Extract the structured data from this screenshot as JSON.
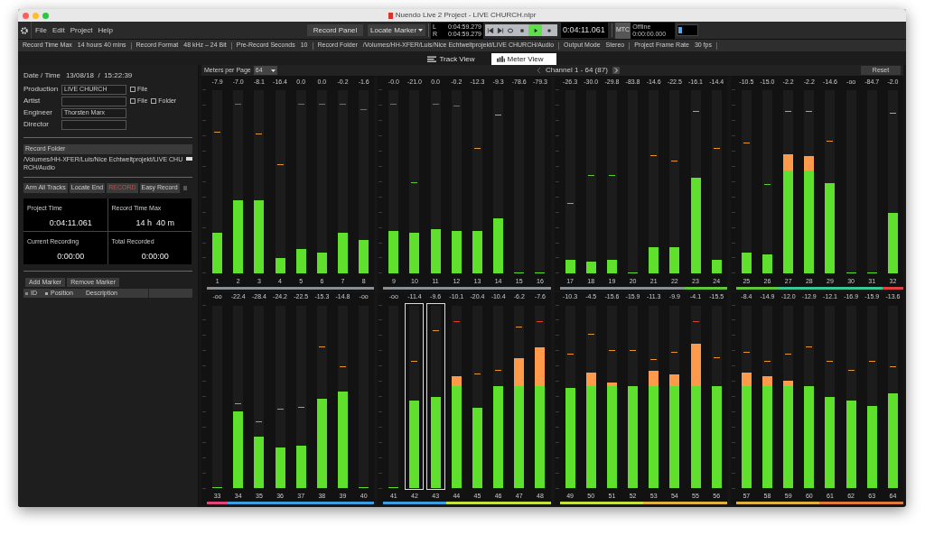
{
  "window": {
    "title": "Nuendo Live 2 Project - LIVE CHURCH.nlpr"
  },
  "menu": [
    "File",
    "Edit",
    "Project",
    "Help"
  ],
  "toolbar": {
    "record_panel": "Record Panel",
    "locate": "Locate Marker",
    "locators": [
      {
        "label": "L",
        "time": "0:04:59.279"
      },
      {
        "label": "R",
        "time": "0:04:59.279"
      }
    ],
    "transport": [
      {
        "kind": "start",
        "active": false
      },
      {
        "kind": "end",
        "active": false
      },
      {
        "kind": "cycle",
        "active": false
      },
      {
        "kind": "stop",
        "active": false
      },
      {
        "kind": "play",
        "active": true
      },
      {
        "kind": "record",
        "active": false
      }
    ],
    "time": "0:04:11.061",
    "mtc": {
      "label": "MTC",
      "status": "Offline",
      "time": "0:00:00.000"
    }
  },
  "info_bar": [
    {
      "label": "Record Time Max",
      "value": "14 hours 40 mins"
    },
    {
      "label": "Record Format",
      "value": "48 kHz – 24 Bit"
    },
    {
      "label": "Pre-Record Seconds",
      "value": "10"
    },
    {
      "label": "Record Folder",
      "value": "/Volumes/HH-XFER/Luis/Nice Echtweltprojekt/LIVE CHURCH/Audio"
    },
    {
      "label": "Output Mode",
      "value": "Stereo"
    },
    {
      "label": "Project Frame Rate",
      "value": "30 fps"
    }
  ],
  "tabs": [
    {
      "label": "Track View",
      "selected": false
    },
    {
      "label": "Meter View",
      "selected": true
    }
  ],
  "left_panel": {
    "datetime": {
      "label": "Date / Time",
      "value": "13/08/18  /  15:22:39"
    },
    "fields": [
      {
        "label": "Production",
        "value": "LIVE CHURCH",
        "checkboxes": [
          {
            "label": "File",
            "checked": false
          }
        ]
      },
      {
        "label": "Artist",
        "checkboxes": [
          {
            "label": "File",
            "checked": false
          },
          {
            "label": "Folder",
            "checked": false
          }
        ]
      },
      {
        "label": "Engineer",
        "value": "Thorsten Marx"
      },
      {
        "label": "Director"
      }
    ],
    "record_folder": {
      "title": "Record Folder",
      "path": "/Volumes/HH-XFER/Luis/Nice Echtweltprojekt/LIVE CHURCH/Audio"
    },
    "buttons": [
      {
        "label": "Arm All Tracks",
        "kind": "normal"
      },
      {
        "label": "Locate End",
        "kind": "normal"
      },
      {
        "label": "RECORD",
        "kind": "record"
      },
      {
        "label": "Easy Record",
        "kind": "normal"
      }
    ],
    "stats": [
      {
        "label": "Project Time",
        "value": "0:04:11.061"
      },
      {
        "label": "Record Time Max",
        "value": "14 h  40 m"
      },
      {
        "label": "Current Recording",
        "value": "0:00:00"
      },
      {
        "label": "Total Recorded",
        "value": "0:00:00"
      }
    ],
    "marker_buttons": [
      "Add Marker",
      "Remove Marker"
    ],
    "marker_columns": [
      "ID",
      "Position",
      "Description"
    ]
  },
  "meters": {
    "meters_per_page": {
      "label": "Meters per Page",
      "value": "64"
    },
    "channel_label": "Channel 1 - 64 (87)",
    "reset": "Reset",
    "rows": [
      {
        "channels": [
          {
            "number": "1",
            "reading": "-7.9",
            "level": 0.22,
            "peak_hold": {
              "level": 0.77
            },
            "color": "#8a8f94",
            "selected": false
          },
          {
            "number": "2",
            "reading": "-7.0",
            "level": 0.4,
            "peak_hold": {
              "level": 0.92
            },
            "color": "#8a8f94",
            "selected": false
          },
          {
            "number": "3",
            "reading": "-8.1",
            "level": 0.4,
            "peak_hold": {
              "level": 0.76
            },
            "color": "#8a8f94",
            "selected": false
          },
          {
            "number": "4",
            "reading": "-16.4",
            "level": 0.08,
            "peak_hold": {
              "level": 0.59
            },
            "color": "#8a8f94",
            "selected": false
          },
          {
            "number": "5",
            "reading": "0.0",
            "level": 0.13,
            "peak_hold": {
              "level": 0.92
            },
            "color": "#8a8f94",
            "selected": false
          },
          {
            "number": "6",
            "reading": "0.0",
            "level": 0.11,
            "peak_hold": {
              "level": 0.92
            },
            "color": "#8a8f94",
            "selected": false
          },
          {
            "number": "7",
            "reading": "-0.2",
            "level": 0.22,
            "peak_hold": {
              "level": 0.92
            },
            "color": "#8a8f94",
            "selected": false
          },
          {
            "number": "8",
            "reading": "-1.6",
            "level": 0.18,
            "peak_hold": {
              "level": 0.89
            },
            "color": "#8a8f94",
            "selected": false
          },
          {
            "number": "9",
            "reading": "-0.0",
            "level": 0.23,
            "peak_hold": {
              "level": 0.92
            },
            "color": "#8a8f94",
            "selected": false
          },
          {
            "number": "10",
            "reading": "-21.0",
            "level": 0.22,
            "peak_hold": {
              "level": 0.49
            },
            "color": "#8a8f94",
            "selected": false
          },
          {
            "number": "11",
            "reading": "0.0",
            "level": 0.24,
            "peak_hold": {
              "level": 0.92
            },
            "color": "#8a8f94",
            "selected": false
          },
          {
            "number": "12",
            "reading": "-0.2",
            "level": 0.23,
            "peak_hold": {
              "level": 0.91
            },
            "color": "#8a8f94",
            "selected": false
          },
          {
            "number": "13",
            "reading": "-12.3",
            "level": 0.23,
            "peak_hold": {
              "level": 0.68
            },
            "color": "#8a8f94",
            "selected": false
          },
          {
            "number": "14",
            "reading": "-9.3",
            "level": 0.3,
            "peak_hold": {
              "level": 0.86
            },
            "color": "#8a8f94",
            "selected": false
          },
          {
            "number": "15",
            "reading": "-78.6",
            "level": 0,
            "color": "#8a8f94",
            "selected": false
          },
          {
            "number": "16",
            "reading": "-79.3",
            "level": 0,
            "color": "#8a8f94",
            "selected": false
          },
          {
            "number": "17",
            "reading": "-26.3",
            "level": 0.07,
            "peak_hold": {
              "level": 0.38
            },
            "color": "#8a8f94",
            "selected": false
          },
          {
            "number": "18",
            "reading": "-30.0",
            "level": 0.06,
            "peak_hold": {
              "level": 0.53
            },
            "color": "#8a8f94",
            "selected": false
          },
          {
            "number": "19",
            "reading": "-29.8",
            "level": 0.07,
            "peak_hold": {
              "level": 0.53
            },
            "color": "#8a8f94",
            "selected": false
          },
          {
            "number": "20",
            "reading": "-83.8",
            "level": 0,
            "color": "#8a8f94",
            "selected": false
          },
          {
            "number": "21",
            "reading": "-14.6",
            "level": 0.14,
            "peak_hold": {
              "level": 0.64
            },
            "color": "#8a8f94",
            "selected": false
          },
          {
            "number": "22",
            "reading": "-22.5",
            "level": 0.14,
            "peak_hold": {
              "level": 0.61
            },
            "color": "#8a8f94",
            "selected": false
          },
          {
            "number": "23",
            "reading": "-16.1",
            "level": 0.52,
            "peak_hold": {
              "level": 0.88
            },
            "color": "#5fc53a",
            "selected": false
          },
          {
            "number": "24",
            "reading": "-14.4",
            "level": 0.07,
            "peak_hold": {
              "level": 0.68
            },
            "color": "#5fc53a",
            "selected": false
          },
          {
            "number": "25",
            "reading": "-10.5",
            "level": 0.11,
            "peak_hold": {
              "level": 0.71
            },
            "color": "#5fc53a",
            "selected": false
          },
          {
            "number": "26",
            "reading": "-15.0",
            "level": 0.1,
            "peak_hold": {
              "level": 0.48
            },
            "color": "#5fc53a",
            "selected": false
          },
          {
            "number": "27",
            "reading": "-2.2",
            "level": 0.65,
            "peak_hold": {
              "level": 0.88
            },
            "color": "#39c79a",
            "selected": false
          },
          {
            "number": "28",
            "reading": "-2.2",
            "level": 0.64,
            "peak_hold": {
              "level": 0.88
            },
            "color": "#39c79a",
            "selected": false
          },
          {
            "number": "29",
            "reading": "-14.6",
            "level": 0.49,
            "peak_hold": {
              "level": 0.72
            },
            "color": "#39c79a",
            "selected": false
          },
          {
            "number": "30",
            "reading": "-oo",
            "level": 0,
            "color": "#39c79a",
            "selected": false
          },
          {
            "number": "31",
            "reading": "-84.7",
            "level": 0,
            "color": "#39c79a",
            "selected": false
          },
          {
            "number": "32",
            "reading": "-2.0",
            "level": 0.33,
            "peak_hold": {
              "level": 0.87
            },
            "color": "#e04040",
            "selected": false
          }
        ]
      },
      {
        "channels": [
          {
            "number": "33",
            "reading": "-oo",
            "level": 0,
            "color": "#e0457b",
            "selected": false
          },
          {
            "number": "34",
            "reading": "-22.4",
            "level": 0.42,
            "peak_hold": {
              "level": 0.46
            },
            "color": "#3b9ee0",
            "selected": false
          },
          {
            "number": "35",
            "reading": "-28.4",
            "level": 0.28,
            "peak_hold": {
              "level": 0.36
            },
            "color": "#3b9ee0",
            "selected": false
          },
          {
            "number": "36",
            "reading": "-24.2",
            "level": 0.22,
            "peak_hold": {
              "level": 0.43
            },
            "color": "#3b9ee0",
            "selected": false
          },
          {
            "number": "37",
            "reading": "-22.5",
            "level": 0.23,
            "peak_hold": {
              "level": 0.44
            },
            "color": "#3b9ee0",
            "selected": false
          },
          {
            "number": "38",
            "reading": "-15.3",
            "level": 0.49,
            "peak_hold": {
              "level": 0.77
            },
            "color": "#3b9ee0",
            "selected": false
          },
          {
            "number": "39",
            "reading": "-14.8",
            "level": 0.53,
            "peak_hold": {
              "level": 0.66
            },
            "color": "#3b9ee0",
            "selected": false
          },
          {
            "number": "40",
            "reading": "-oo",
            "level": 0,
            "color": "#3b9ee0",
            "selected": false
          },
          {
            "number": "41",
            "reading": "-oo",
            "level": 0,
            "color": "#3b9ee0",
            "selected": false
          },
          {
            "number": "42",
            "reading": "-11.4",
            "level": 0.48,
            "peak_hold": {
              "level": 0.69
            },
            "color": "#3b9ee0",
            "selected": true
          },
          {
            "number": "43",
            "reading": "-9.6",
            "level": 0.5,
            "peak_hold": {
              "level": 0.86
            },
            "color": "#3b9ee0",
            "selected": true
          },
          {
            "number": "44",
            "reading": "-10.1",
            "level": 0.61,
            "peak_hold": {
              "level": 0.91
            },
            "color": "#c8e03c",
            "selected": false
          },
          {
            "number": "45",
            "reading": "-20.4",
            "level": 0.44,
            "peak_hold": {
              "level": 0.62
            },
            "color": "#c8e03c",
            "selected": false
          },
          {
            "number": "46",
            "reading": "-10.4",
            "level": 0.56,
            "peak_hold": {
              "level": 0.64
            },
            "color": "#c8e03c",
            "selected": false
          },
          {
            "number": "47",
            "reading": "-6.2",
            "level": 0.71,
            "peak_hold": {
              "level": 0.88
            },
            "color": "#c8e03c",
            "selected": false
          },
          {
            "number": "48",
            "reading": "-7.6",
            "level": 0.77,
            "peak_hold": {
              "level": 0.91
            },
            "color": "#c8e03c",
            "selected": false
          },
          {
            "number": "49",
            "reading": "-10.3",
            "level": 0.55,
            "peak_hold": {
              "level": 0.73
            },
            "color": "#c8e03c",
            "selected": false
          },
          {
            "number": "50",
            "reading": "-4.5",
            "level": 0.63,
            "peak_hold": {
              "level": 0.84
            },
            "color": "#c8e03c",
            "selected": false
          },
          {
            "number": "51",
            "reading": "-15.6",
            "level": 0.58,
            "peak_hold": {
              "level": 0.75
            },
            "color": "#c8e03c",
            "selected": false
          },
          {
            "number": "52",
            "reading": "-15.9",
            "level": 0.56,
            "peak_hold": {
              "level": 0.75
            },
            "color": "#c8e03c",
            "selected": false
          },
          {
            "number": "53",
            "reading": "-11.3",
            "level": 0.64,
            "peak_hold": {
              "level": 0.7
            },
            "color": "#e0b03c",
            "selected": false
          },
          {
            "number": "54",
            "reading": "-9.9",
            "level": 0.62,
            "peak_hold": {
              "level": 0.74
            },
            "color": "#e0b03c",
            "selected": false
          },
          {
            "number": "55",
            "reading": "-4.1",
            "level": 0.79,
            "peak_hold": {
              "level": 0.91
            },
            "color": "#e0b03c",
            "selected": false
          },
          {
            "number": "56",
            "reading": "-15.5",
            "level": 0.56,
            "peak_hold": {
              "level": 0.71
            },
            "color": "#e0b03c",
            "selected": false
          },
          {
            "number": "57",
            "reading": "-8.4",
            "level": 0.63,
            "peak_hold": {
              "level": 0.74
            },
            "color": "#e0b03c",
            "selected": false
          },
          {
            "number": "58",
            "reading": "-14.9",
            "level": 0.61,
            "peak_hold": {
              "level": 0.69
            },
            "color": "#e0b03c",
            "selected": false
          },
          {
            "number": "59",
            "reading": "-12.0",
            "level": 0.59,
            "peak_hold": {
              "level": 0.73
            },
            "color": "#e0b03c",
            "selected": false
          },
          {
            "number": "60",
            "reading": "-12.9",
            "level": 0.56,
            "peak_hold": {
              "level": 0.77
            },
            "color": "#e0b03c",
            "selected": false
          },
          {
            "number": "61",
            "reading": "-12.1",
            "level": 0.5,
            "peak_hold": {
              "level": 0.69
            },
            "color": "#e07a3c",
            "selected": false
          },
          {
            "number": "62",
            "reading": "-16.9",
            "level": 0.48,
            "peak_hold": {
              "level": 0.64
            },
            "color": "#e07a3c",
            "selected": false
          },
          {
            "number": "63",
            "reading": "-15.9",
            "level": 0.45,
            "peak_hold": {
              "level": 0.69
            },
            "color": "#e07a3c",
            "selected": false
          },
          {
            "number": "64",
            "reading": "-13.6",
            "level": 0.52,
            "peak_hold": {
              "level": 0.66
            },
            "color": "#e07a3c",
            "selected": false
          }
        ]
      }
    ]
  }
}
